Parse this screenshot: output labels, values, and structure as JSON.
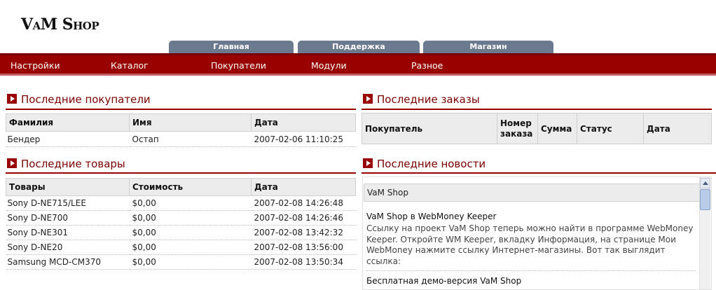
{
  "header": {
    "logo": "VaM Shop"
  },
  "tabs": [
    {
      "label": "Главная"
    },
    {
      "label": "Поддержка"
    },
    {
      "label": "Магазин"
    }
  ],
  "menu": [
    {
      "label": "Настройки"
    },
    {
      "label": "Каталог"
    },
    {
      "label": "Покупатели"
    },
    {
      "label": "Модули"
    },
    {
      "label": "Разное"
    }
  ],
  "customers": {
    "title": "Последние покупатели",
    "columns": [
      "Фамилия",
      "Имя",
      "Дата"
    ],
    "rows": [
      [
        "Бендер",
        "Остап",
        "2007-02-06 11:10:25"
      ]
    ]
  },
  "products": {
    "title": "Последние товары",
    "columns": [
      "Товары",
      "Стоимость",
      "Дата"
    ],
    "rows": [
      [
        "Sony D-NE715/LEE",
        "$0,00",
        "2007-02-08 14:26:48"
      ],
      [
        "Sony D-NE700",
        "$0,00",
        "2007-02-08 14:26:46"
      ],
      [
        "Sony D-NE301",
        "$0,00",
        "2007-02-08 13:42:32"
      ],
      [
        "Sony D-NE20",
        "$0,00",
        "2007-02-08 13:56:00"
      ],
      [
        "Samsung MCD-CM370",
        "$0,00",
        "2007-02-08 13:50:34"
      ]
    ]
  },
  "orders": {
    "title": "Последние заказы",
    "columns": [
      "Покупатель",
      "Номер заказа",
      "Сумма",
      "Статус",
      "Дата"
    ]
  },
  "news": {
    "title": "Последние новости",
    "feed_title": "VaM Shop",
    "items": [
      {
        "title": "VaM Shop в WebMoney Keeper",
        "text": "Ссылку на проект VaM Shop теперь можно найти в программе WebMoney Keeper. Откройте WM Keeper, вкладку Информация, на странице Мои WebMoney нажмите ссылку Интернет-магазины. Вот так выглядит ссылка:"
      },
      {
        "title": "Бесплатная демо-версия VaM Shop"
      }
    ]
  }
}
